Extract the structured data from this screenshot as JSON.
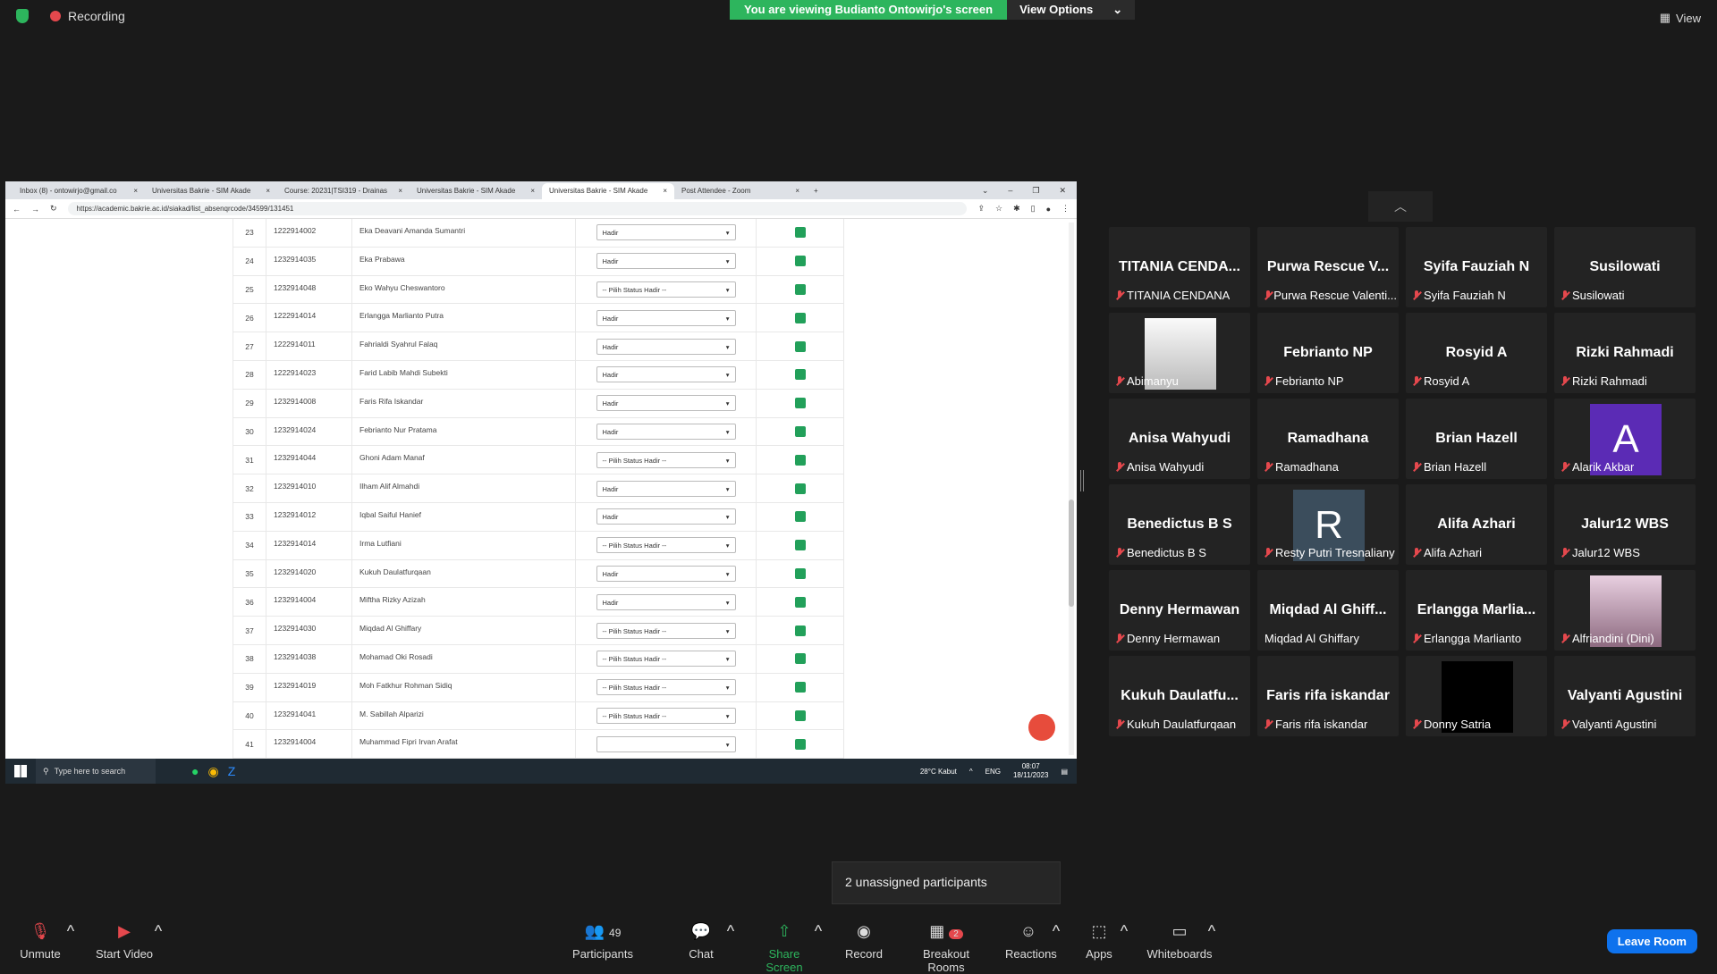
{
  "top": {
    "recording": "Recording",
    "banner": "You are viewing Budianto Ontowirjo's screen",
    "view_options": "View Options",
    "view": "View"
  },
  "browser": {
    "tabs": [
      {
        "title": "Inbox (8) - ontowirjo@gmail.co"
      },
      {
        "title": "Universitas Bakrie - SIM Akade"
      },
      {
        "title": "Course: 20231|TSI319 - Drainas"
      },
      {
        "title": "Universitas Bakrie - SIM Akade"
      },
      {
        "title": "Universitas Bakrie - SIM Akade"
      },
      {
        "title": "Post Attendee - Zoom"
      }
    ],
    "url": "https://academic.bakrie.ac.id/siakad/list_absenqrcode/34599/131451"
  },
  "attendance": {
    "rows": [
      {
        "no": "23",
        "nim": "1222914002",
        "name": "Eka Deavani Amanda Sumantri",
        "status": "Hadir"
      },
      {
        "no": "24",
        "nim": "1232914035",
        "name": "Eka Prabawa",
        "status": "Hadir"
      },
      {
        "no": "25",
        "nim": "1232914048",
        "name": "Eko Wahyu Cheswantoro",
        "status": "-- Pilih Status Hadir --"
      },
      {
        "no": "26",
        "nim": "1222914014",
        "name": "Erlangga Marlianto Putra",
        "status": "Hadir"
      },
      {
        "no": "27",
        "nim": "1222914011",
        "name": "Fahrialdi Syahrul Falaq",
        "status": "Hadir"
      },
      {
        "no": "28",
        "nim": "1222914023",
        "name": "Farid Labib Mahdi Subekti",
        "status": "Hadir"
      },
      {
        "no": "29",
        "nim": "1232914008",
        "name": "Faris Rifa Iskandar",
        "status": "Hadir"
      },
      {
        "no": "30",
        "nim": "1232914024",
        "name": "Febrianto Nur Pratama",
        "status": "Hadir"
      },
      {
        "no": "31",
        "nim": "1232914044",
        "name": "Ghoni Adam Manaf",
        "status": "-- Pilih Status Hadir --"
      },
      {
        "no": "32",
        "nim": "1232914010",
        "name": "Ilham Alif Almahdi",
        "status": "Hadir"
      },
      {
        "no": "33",
        "nim": "1232914012",
        "name": "Iqbal Saiful Hanief",
        "status": "Hadir"
      },
      {
        "no": "34",
        "nim": "1232914014",
        "name": "Irma Lutfiani",
        "status": "-- Pilih Status Hadir --"
      },
      {
        "no": "35",
        "nim": "1232914020",
        "name": "Kukuh Daulatfurqaan",
        "status": "Hadir"
      },
      {
        "no": "36",
        "nim": "1232914004",
        "name": "Miftha Rizky Azizah",
        "status": "Hadir"
      },
      {
        "no": "37",
        "nim": "1232914030",
        "name": "Miqdad Al Ghiffary",
        "status": "-- Pilih Status Hadir --"
      },
      {
        "no": "38",
        "nim": "1232914038",
        "name": "Mohamad Oki Rosadi",
        "status": "-- Pilih Status Hadir --"
      },
      {
        "no": "39",
        "nim": "1232914019",
        "name": "Moh Fatkhur Rohman Sidiq",
        "status": "-- Pilih Status Hadir --"
      },
      {
        "no": "40",
        "nim": "1232914041",
        "name": "M. Sabillah Alparizi",
        "status": "-- Pilih Status Hadir --"
      },
      {
        "no": "41",
        "nim": "1232914004",
        "name": "Muhammad Fipri Irvan Arafat",
        "status": ""
      }
    ]
  },
  "taskbar": {
    "search": "Type here to search",
    "weather": "28°C  Kabut",
    "lang": "ENG",
    "time": "08:07",
    "date": "18/11/2023"
  },
  "participants": [
    {
      "big": "TITANIA CENDA...",
      "name": "TITANIA CENDANA",
      "muted": true
    },
    {
      "big": "Purwa Rescue V...",
      "name": "Purwa Rescue Valenti...",
      "muted": true
    },
    {
      "big": "Syifa Fauziah N",
      "name": "Syifa Fauziah N",
      "muted": true
    },
    {
      "big": "Susilowati",
      "name": "Susilowati",
      "muted": true
    },
    {
      "big": "",
      "name": "Abimanyu",
      "muted": true,
      "avatar": "photo-city"
    },
    {
      "big": "Febrianto NP",
      "name": "Febrianto NP",
      "muted": true
    },
    {
      "big": "Rosyid A",
      "name": "Rosyid A",
      "muted": true
    },
    {
      "big": "Rizki Rahmadi",
      "name": "Rizki Rahmadi",
      "muted": true
    },
    {
      "big": "Anisa Wahyudi",
      "name": "Anisa Wahyudi",
      "muted": true
    },
    {
      "big": "Ramadhana",
      "name": "Ramadhana",
      "muted": true
    },
    {
      "big": "Brian Hazell",
      "name": "Brian Hazell",
      "muted": true
    },
    {
      "big": "",
      "name": "Alarik Akbar",
      "muted": true,
      "avatar_letter": "A",
      "avatar_color": "#5b2bb5"
    },
    {
      "big": "Benedictus B S",
      "name": "Benedictus B S",
      "muted": true
    },
    {
      "big": "",
      "name": "Resty Putri Tresnaliany",
      "muted": true,
      "avatar_letter": "R",
      "avatar_color": "#3b4d5c"
    },
    {
      "big": "Alifa Azhari",
      "name": "Alifa Azhari",
      "muted": true
    },
    {
      "big": "Jalur12 WBS",
      "name": "Jalur12 WBS",
      "muted": true
    },
    {
      "big": "Denny Hermawan",
      "name": "Denny Hermawan",
      "muted": true
    },
    {
      "big": "Miqdad Al Ghiff...",
      "name": "Miqdad Al Ghiffary",
      "muted": false
    },
    {
      "big": "Erlangga  Marlia...",
      "name": "Erlangga Marlianto",
      "muted": true
    },
    {
      "big": "",
      "name": "Alfriandini (Dini)",
      "muted": true,
      "avatar": "photo-person"
    },
    {
      "big": "Kukuh  Daulatfu...",
      "name": "Kukuh Daulatfurqaan",
      "muted": true
    },
    {
      "big": "Faris rifa iskandar",
      "name": "Faris rifa iskandar",
      "muted": true
    },
    {
      "big": "",
      "name": "Donny Satria",
      "muted": true,
      "avatar": "black"
    },
    {
      "big": "Valyanti Agustini",
      "name": "Valyanti Agustini",
      "muted": true
    }
  ],
  "popup": {
    "unassigned": "2 unassigned participants"
  },
  "toolbar": {
    "unmute": "Unmute",
    "start_video": "Start Video",
    "participants": "Participants",
    "participants_count": "49",
    "chat": "Chat",
    "share_screen": "Share Screen",
    "record": "Record",
    "breakout_rooms": "Breakout Rooms",
    "breakout_badge": "2",
    "reactions": "Reactions",
    "apps": "Apps",
    "whiteboards": "Whiteboards",
    "leave": "Leave Room"
  },
  "colors": {
    "accent_green": "#2db55d",
    "leave_blue": "#0e72ed",
    "muted_red": "#e5484d"
  }
}
